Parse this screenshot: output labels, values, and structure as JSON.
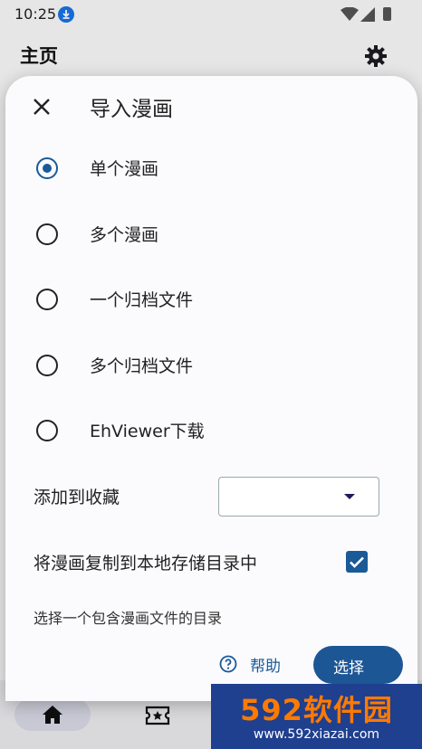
{
  "status_bar": {
    "time": "10:25"
  },
  "app_bar": {
    "title": "主页"
  },
  "dialog": {
    "title": "导入漫画",
    "options": [
      {
        "label": "单个漫画",
        "selected": true
      },
      {
        "label": "多个漫画",
        "selected": false
      },
      {
        "label": "一个归档文件",
        "selected": false
      },
      {
        "label": "多个归档文件",
        "selected": false
      },
      {
        "label": "EhViewer下载",
        "selected": false
      }
    ],
    "favorite": {
      "label": "添加到收藏",
      "value": ""
    },
    "copy_local": {
      "label": "将漫画复制到本地存储目录中",
      "checked": true
    },
    "hint": "选择一个包含漫画文件的目录",
    "help_label": "帮助",
    "select_label": "选择"
  },
  "watermark": {
    "brand": "592软件园",
    "url": "www.592xiazai.com"
  },
  "colors": {
    "accent": "#1a5a97",
    "button": "#1d5694"
  }
}
